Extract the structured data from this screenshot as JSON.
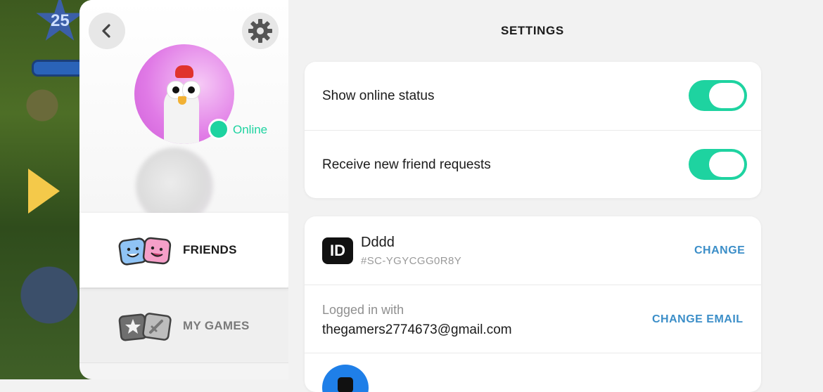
{
  "game_background": {
    "level_number": "25"
  },
  "profile": {
    "status": "Online",
    "status_color": "#1ed3a0"
  },
  "nav": {
    "items": [
      {
        "label": "FRIENDS",
        "icon": "friends-faces-icon",
        "selected": true
      },
      {
        "label": "MY GAMES",
        "icon": "games-cards-icon",
        "selected": false
      }
    ]
  },
  "settings": {
    "title": "SETTINGS",
    "toggles": [
      {
        "label": "Show online status",
        "on": true
      },
      {
        "label": "Receive new friend requests",
        "on": true
      }
    ],
    "account": {
      "id_badge": "ID",
      "username": "Dddd",
      "user_code": "#SC-YGYCGG0R8Y",
      "change_label": "CHANGE",
      "logged_in_label": "Logged in with",
      "email": "thegamers2774673@gmail.com",
      "change_email_label": "CHANGE EMAIL"
    },
    "accent_color": "#1ed3a0",
    "link_color": "#3b8ec8"
  }
}
